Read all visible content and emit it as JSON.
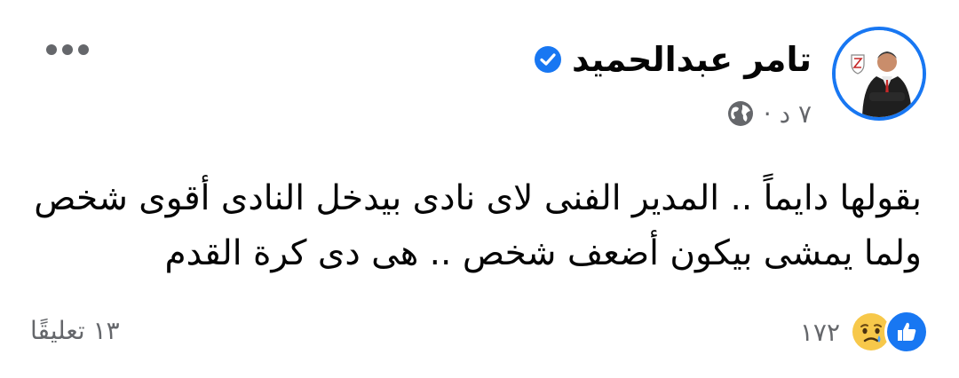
{
  "post": {
    "author_name": "تامر عبدالحميد",
    "verified": true,
    "time": "٧ د ·",
    "privacy_icon": "globe-icon",
    "text_lines": [
      "بقولها دايماً .. المدير الفنى لاى نادى بيدخل النادى أقوى شخص",
      "ولما يمشى بيكون أضعف شخص .. هى دى كرة القدم"
    ]
  },
  "footer": {
    "reaction_icons": [
      "like-icon",
      "sad-icon"
    ],
    "reaction_count": "١٧٢",
    "comments": "١٣ تعليقًا"
  },
  "colors": {
    "accent": "#1877f2",
    "secondary_text": "#65676b",
    "text": "#050505"
  }
}
